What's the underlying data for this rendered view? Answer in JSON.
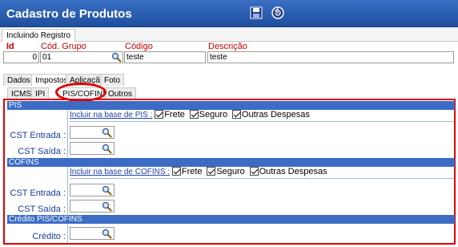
{
  "window": {
    "title": "Cadastro de Produtos"
  },
  "toolbar": {
    "save_icon": "floppy-disk-icon",
    "undo_icon": "undo-icon"
  },
  "mode_tab": "Incluindo Registro",
  "header": {
    "id_label": "Id",
    "id_value": "0",
    "grupo_label": "Cód. Grupo",
    "grupo_value": "01",
    "codigo_label": "Código",
    "codigo_value": "teste",
    "descricao_label": "Descrição",
    "descricao_value": "teste"
  },
  "main_tabs": [
    "Dados",
    "Impostos",
    "Aplicação",
    "Foto"
  ],
  "tax_tabs": [
    "ICMS",
    "IPI",
    "PIS/COFINS",
    "Outros"
  ],
  "pis": {
    "section_title": "PIS",
    "include_label": "Incluir na base de PIS :",
    "options": [
      "Frete",
      "Seguro",
      "Outras Despesas"
    ],
    "cst_entrada_label": "CST Entrada :",
    "cst_saida_label": "CST Saída :"
  },
  "cofins": {
    "section_title": "COFINS",
    "include_label": "Incluir na base de COFINS :",
    "options": [
      "Frete",
      "Seguro",
      "Outras Despesas"
    ],
    "cst_entrada_label": "CST Entrada :",
    "cst_saida_label": "CST Saída :"
  },
  "credito": {
    "section_title": "Crédito PIS/COFINS",
    "credito_label": "Crédito :"
  },
  "colors": {
    "title_bar": "#2a5bb0",
    "section_header": "#3c6cc4",
    "highlight": "#e00000",
    "label_blue": "#1a3c9c",
    "required_red": "#cc0000"
  }
}
